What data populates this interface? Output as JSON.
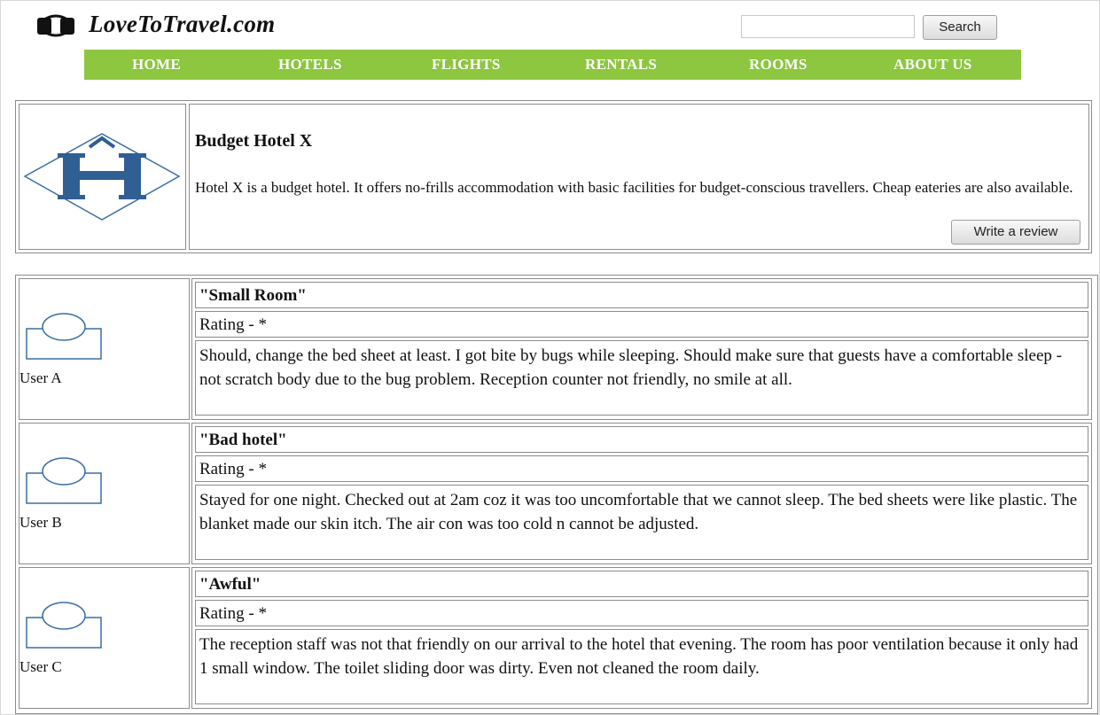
{
  "site": {
    "title": "LoveToTravel.com",
    "logo_icon": "suitcase-logo-icon"
  },
  "search": {
    "value": "",
    "placeholder": "",
    "button_label": "Search"
  },
  "nav": {
    "items": [
      {
        "label": "HOME"
      },
      {
        "label": "HOTELS"
      },
      {
        "label": "FLIGHTS"
      },
      {
        "label": "RENTALS"
      },
      {
        "label": "ROOMS"
      },
      {
        "label": "ABOUT US"
      }
    ],
    "color": "#8dc63f"
  },
  "hotel": {
    "logo_icon": "hotel-h-logo-icon",
    "name": "Budget Hotel X",
    "description": "Hotel X is a budget hotel. It offers no-frills accommodation with basic facilities for budget-conscious travellers. Cheap eateries are also available.",
    "write_review_label": "Write a review"
  },
  "reviews": [
    {
      "user": "User A",
      "avatar_icon": "user-avatar-icon",
      "title": "\"Small Room\"",
      "rating": "Rating - *",
      "text": "Should, change the bed sheet at least. I got bite by bugs while sleeping. Should make sure that guests have a comfortable sleep - not scratch body due to the bug problem. Reception counter not friendly, no smile at all."
    },
    {
      "user": "User B",
      "avatar_icon": "user-avatar-icon",
      "title": "\"Bad hotel\"",
      "rating": "Rating - *",
      "text": "Stayed for one night. Checked out at 2am coz it was too uncomfortable that we cannot sleep. The bed sheets were like plastic. The blanket made our skin itch. The air con was too cold n cannot be adjusted."
    },
    {
      "user": "User C",
      "avatar_icon": "user-avatar-icon",
      "title": "\"Awful\"",
      "rating": "Rating - *",
      "text": "The reception staff was not that friendly on our arrival to the hotel that evening. The room has poor ventilation because it only had 1 small window. The toilet sliding door was dirty. Even not cleaned the room daily."
    }
  ]
}
